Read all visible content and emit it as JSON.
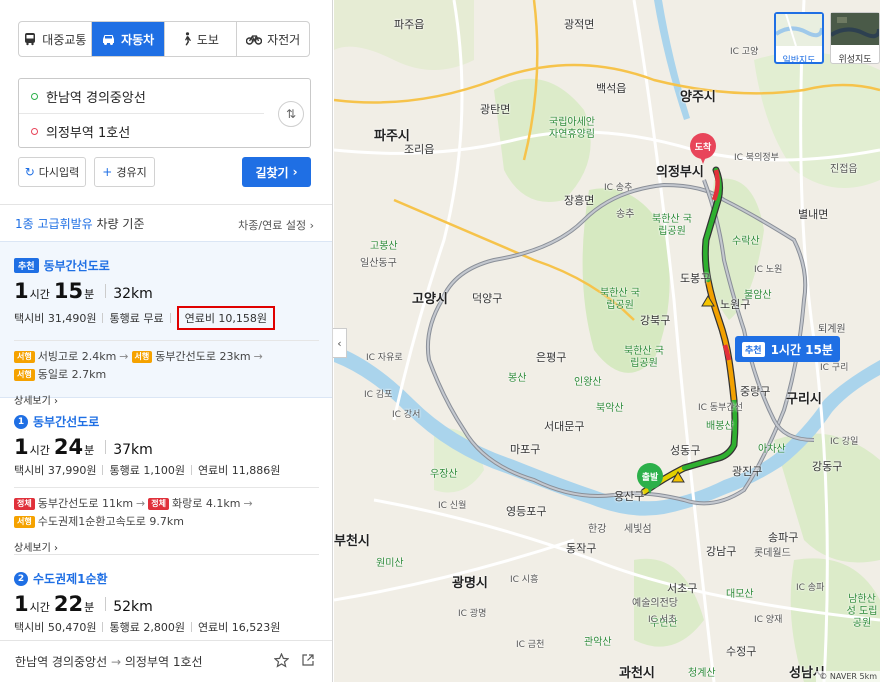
{
  "modes": [
    {
      "label": "대중교통",
      "icon": "bus-icon",
      "active": false
    },
    {
      "label": "자동차",
      "icon": "car-icon",
      "active": true
    },
    {
      "label": "도보",
      "icon": "walk-icon",
      "active": false
    },
    {
      "label": "자전거",
      "icon": "bike-icon",
      "active": false
    }
  ],
  "origin": "한남역 경의중앙선",
  "destination": "의정부역 1호선",
  "buttons": {
    "reset": "다시입력",
    "waypoint": "경유지",
    "find": "길찾기"
  },
  "criteria": {
    "highlight": "1종 고급휘발유",
    "rest": " 차량 기준",
    "vehicle_setting": "차종/연료 설정"
  },
  "routes": [
    {
      "badge": "추천",
      "index": "",
      "name": "동부간선도로",
      "hours": "1",
      "hour_unit": "시간",
      "minutes": "15",
      "minute_unit": "분",
      "distance": "32km",
      "taxi": "택시비 31,490원",
      "toll": "통행료 무료",
      "fuel": "연료비 10,158원",
      "roads": [
        {
          "tag": "서행",
          "tag_color": "#f5a200",
          "text": "서빙고로 2.4km"
        },
        {
          "tag": "서행",
          "tag_color": "#f5a200",
          "text": "동부간선도로 23km"
        },
        {
          "tag": "서행",
          "tag_color": "#f5a200",
          "text": "동일로 2.7km"
        }
      ],
      "detail": "상세보기"
    },
    {
      "badge": "",
      "index": "1",
      "name": "동부간선도로",
      "hours": "1",
      "hour_unit": "시간",
      "minutes": "24",
      "minute_unit": "분",
      "distance": "37km",
      "taxi": "택시비 37,990원",
      "toll": "통행료 1,100원",
      "fuel": "연료비 11,886원",
      "roads": [
        {
          "tag": "정체",
          "tag_color": "#e0303a",
          "text": "동부간선도로 11km"
        },
        {
          "tag": "정체",
          "tag_color": "#e0303a",
          "text": "화랑로 4.1km"
        },
        {
          "tag": "서행",
          "tag_color": "#f5a200",
          "text": "수도권제1순환고속도로 9.7km"
        }
      ],
      "detail": "상세보기"
    },
    {
      "badge": "",
      "index": "2",
      "name": "수도권제1순환",
      "hours": "1",
      "hour_unit": "시간",
      "minutes": "22",
      "minute_unit": "분",
      "distance": "52km",
      "taxi": "택시비 50,470원",
      "toll": "통행료 2,800원",
      "fuel": "연료비 16,523원"
    }
  ],
  "footer": {
    "from": "한남역 경의중앙선",
    "arrow": "→",
    "to": "의정부역 1호선"
  },
  "map": {
    "rec_badge": "추천",
    "rec_time": "1시간 15분",
    "start_pin": "출발",
    "end_pin": "도착",
    "maptype_normal": "일반지도",
    "maptype_satellite": "위성지도",
    "copyright": "© NAVER  5km",
    "cities": [
      "양주시",
      "파주시",
      "의정부시",
      "고양시",
      "구리시",
      "광명시",
      "과천시",
      "성남시",
      "부천시"
    ],
    "districts": [
      "파주읍",
      "광적면",
      "백석읍",
      "광탄면",
      "조리읍",
      "장흥면",
      "도봉구",
      "노원구",
      "강북구",
      "은평구",
      "서대문구",
      "마포구",
      "중랑구",
      "광진구",
      "성동구",
      "용산구",
      "영등포구",
      "동작구",
      "강동구",
      "강남구",
      "서초구",
      "송파구",
      "덕양구",
      "일산동구",
      "고봉산",
      "송추",
      "별내면",
      "수락산",
      "불암산",
      "북한산 국립공원",
      "북한산 국립공원",
      "북한산 국립공원",
      "국립아세안 자연휴양림",
      "봉산",
      "북악산",
      "배봉산",
      "아차산",
      "우장산",
      "원미산",
      "관악산",
      "대모산",
      "청계산",
      "남한산성 도립공원",
      "우면산",
      "수정구",
      "퇴계원",
      "진접읍",
      "인왕산",
      "한강",
      "세빛섬",
      "예술의전당",
      "롯데월드"
    ],
    "ics": [
      "IC 고양",
      "IC 북의정부",
      "IC 송추",
      "IC 노원",
      "IC 구리",
      "IC 강일",
      "IC 자유로",
      "IC 김포",
      "IC 강서",
      "IC 신월",
      "IC 시흥",
      "IC 광명",
      "IC 금천",
      "IC 동부간선",
      "IC 송파",
      "IC 서초",
      "IC 양재"
    ]
  }
}
